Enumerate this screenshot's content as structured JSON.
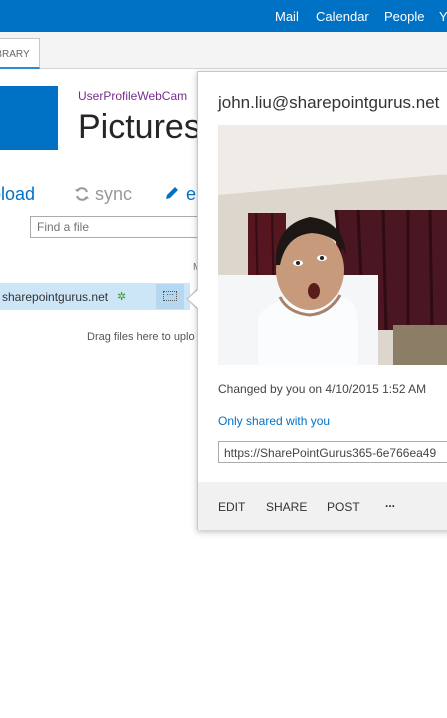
{
  "topnav": {
    "mail": "Mail",
    "calendar": "Calendar",
    "people": "People",
    "more": "Y"
  },
  "ribbon": {
    "library_tab": "LIBRARY"
  },
  "site": {
    "name": "UserProfileWebCam",
    "title": "Pictures"
  },
  "commands": {
    "upload": "upload",
    "sync": "sync",
    "edit": "e",
    "upload_icon": "upload-arrow-icon",
    "sync_icon": "sync-icon",
    "edit_icon": "pencil-icon"
  },
  "search": {
    "placeholder": "Find a file"
  },
  "list": {
    "column_header": "M",
    "selected_item": "sharepointgurus.net",
    "drag_hint": "Drag files here to uplo"
  },
  "callout": {
    "title": "john.liu@sharepointgurus.net",
    "changed": "Changed by you on 4/10/2015 1:52 AM",
    "shared": "Only shared with you",
    "url": "https://SharePointGurus365-6e766ea49",
    "actions": {
      "edit": "EDIT",
      "share": "SHARE",
      "post": "POST",
      "more": "..."
    }
  },
  "colors": {
    "accent": "#0072c6",
    "site_name": "#7a2a8f",
    "selection": "#cde6f7"
  }
}
